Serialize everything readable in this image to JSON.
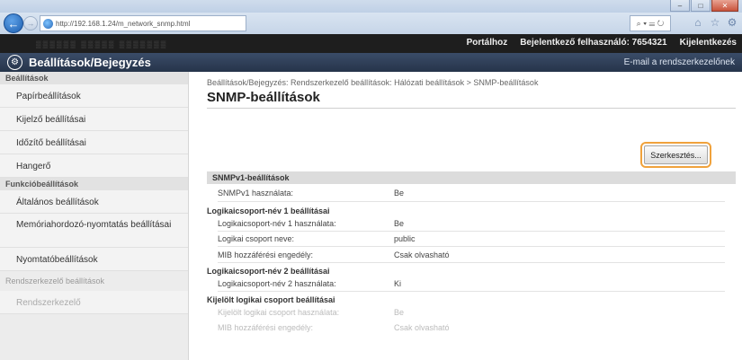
{
  "browser": {
    "url": "http://192.168.1.24/m_network_snmp.html",
    "search_symbols": "⌕ ▾ ☰ ↻",
    "window_buttons": [
      "–",
      "□",
      "✕"
    ],
    "icons": [
      "⌂",
      "☆",
      "⚙"
    ]
  },
  "portal": {
    "links": [
      "Portálhoz",
      "Bejelentkező felhasználó: 7654321",
      "Kijelentkezés"
    ]
  },
  "header": {
    "title": "Beállítások/Bejegyzés",
    "email_link": "E-mail a rendszerkezelőnek"
  },
  "sidebar": {
    "section1": "Beállítások",
    "items1": [
      "Papírbeállítások",
      "Kijelző beállításai",
      "Időzítő beállításai",
      "Hangerő"
    ],
    "section2": "Funkcióbeállítások",
    "items2": [
      "Általános beállítások",
      "Memóriahordozó-nyomtatás beállításai",
      "Nyomtatóbeállítások"
    ],
    "section3": "Rendszerkezelő beállítások",
    "item3": "Rendszerkezelő"
  },
  "main": {
    "breadcrumb": "Beállítások/Bejegyzés: Rendszerkezelő beállítások: Hálózati beállítások > SNMP-beállítások",
    "title": "SNMP-beállítások",
    "edit_button": "Szerkesztés...",
    "section": "SNMPv1-beállítások",
    "snmpv1_label": "SNMPv1 használata:",
    "snmpv1_value": "Be",
    "group1_head": "Logikaicsoport-név 1 beállításai",
    "group1_rows": [
      {
        "label": "Logikaicsoport-név 1 használata:",
        "value": "Be"
      },
      {
        "label": "Logikai csoport neve:",
        "value": "public"
      },
      {
        "label": "MIB hozzáférési engedély:",
        "value": "Csak olvasható"
      }
    ],
    "group2_head": "Logikaicsoport-név 2 beállításai",
    "group2_rows": [
      {
        "label": "Logikaicsoport-név 2 használata:",
        "value": "Ki"
      }
    ],
    "group3_head": "Kijelölt logikai csoport beállításai",
    "group3_rows": [
      {
        "label": "Kijelölt logikai csoport használata:",
        "value": "Be"
      },
      {
        "label": "MIB hozzáférési engedély:",
        "value": "Csak olvasható"
      }
    ]
  }
}
